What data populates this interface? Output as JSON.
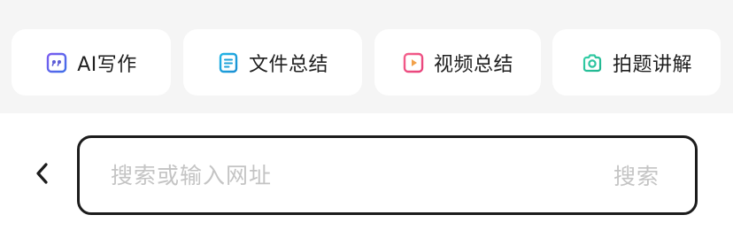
{
  "quick_actions": [
    {
      "label": "AI写作",
      "icon": "quote-icon",
      "color": "#5b5bd6"
    },
    {
      "label": "文件总结",
      "icon": "document-icon",
      "color": "#1fa2d8"
    },
    {
      "label": "视频总结",
      "icon": "play-icon",
      "color": "#e8417a"
    },
    {
      "label": "拍题讲解",
      "icon": "camera-icon",
      "color": "#2bc4a0"
    }
  ],
  "search": {
    "placeholder": "搜索或输入网址",
    "value": "",
    "button_label": "搜索"
  },
  "nav": {
    "back_icon": "chevron-left-icon"
  }
}
